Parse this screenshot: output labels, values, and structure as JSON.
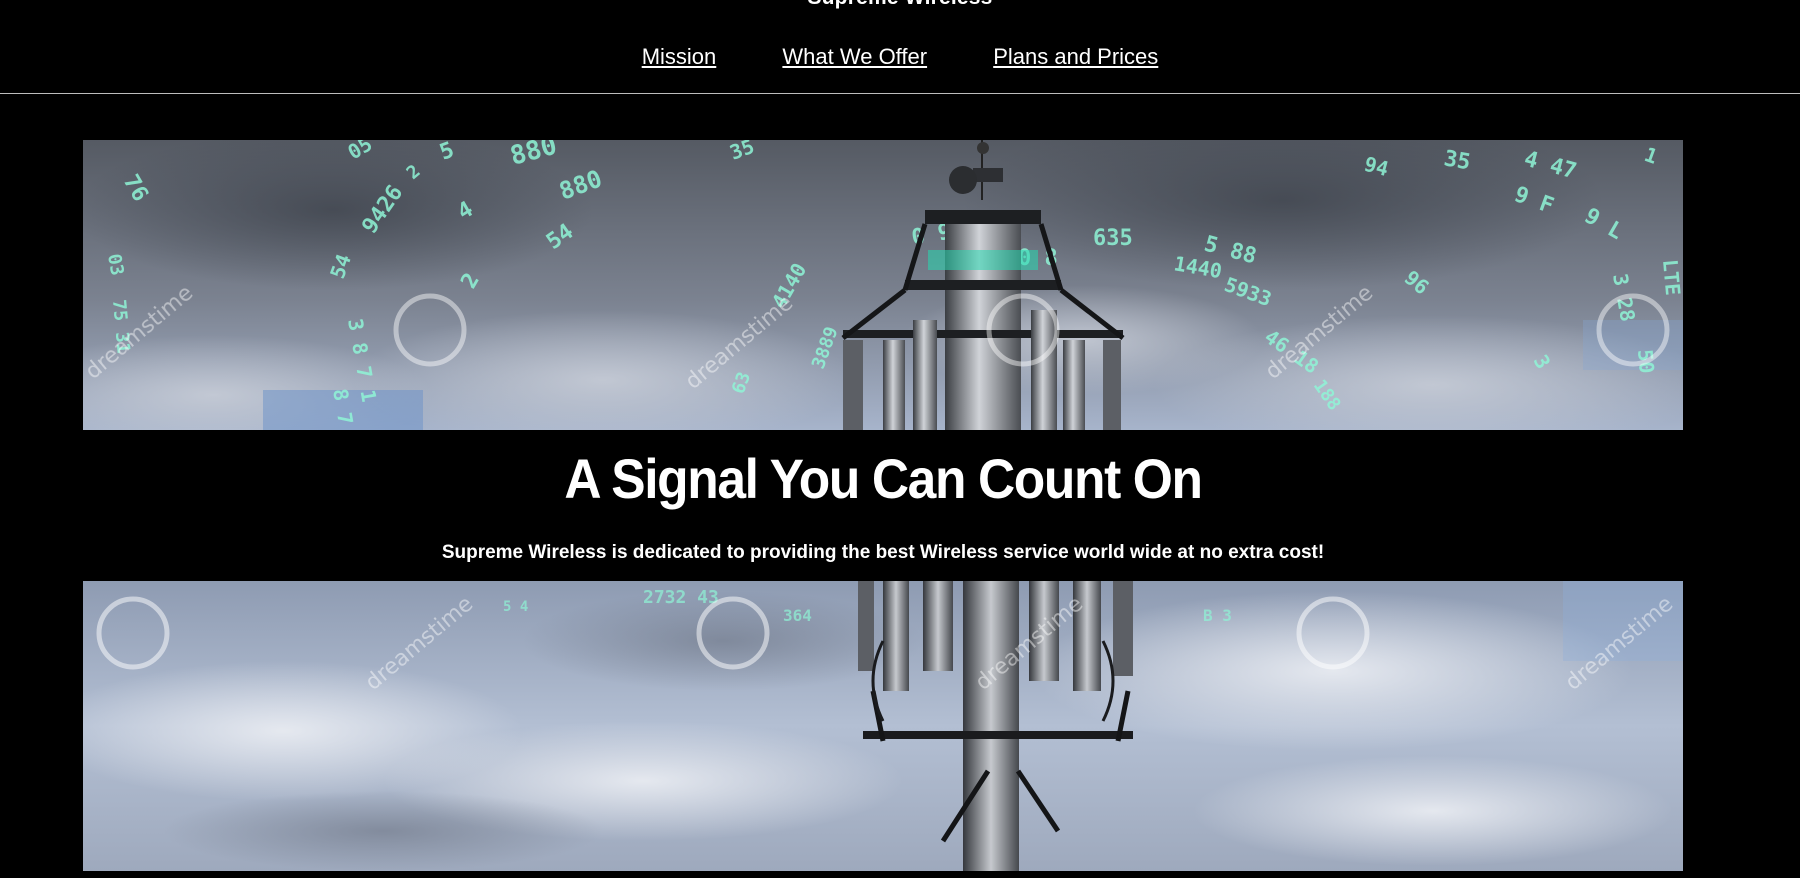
{
  "header": {
    "site_title": "Supreme Wireless",
    "nav": [
      {
        "label": "Mission"
      },
      {
        "label": "What We Offer"
      },
      {
        "label": "Plans and Prices"
      }
    ]
  },
  "hero": {
    "top_image": {
      "watermark": "dreamstime"
    },
    "headline": "A Signal You Can Count On",
    "tagline": "Supreme Wireless is dedicated to providing the best Wireless service world wide at no extra cost!",
    "bottom_image": {
      "watermark": "dreamstime"
    }
  },
  "colors": {
    "background": "#000000",
    "text": "#ffffff",
    "divider": "#bdbdbd",
    "digit_glow": "#7fffd4",
    "sky_top": "#4e535d",
    "sky_bottom": "#a9b7cf"
  }
}
